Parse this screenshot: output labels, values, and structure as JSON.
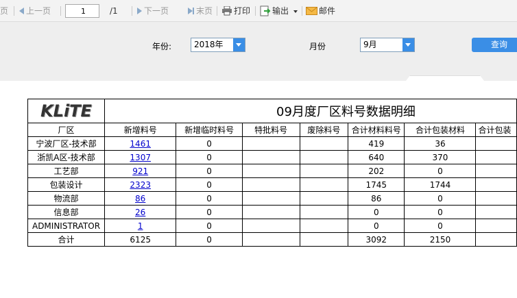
{
  "toolbar": {
    "first_page": "页",
    "prev_page": "上一页",
    "page_number": "1",
    "page_total": "/1",
    "next_page": "下一页",
    "last_page": "末页",
    "print": "打印",
    "export": "输出",
    "email": "邮件"
  },
  "query": {
    "year_label": "年份:",
    "year_value": "2018年",
    "month_label": "月份",
    "month_value": "9月",
    "query_button": "查询"
  },
  "report": {
    "logo": "KLiTE",
    "title": "09月度厂区料号数据明细",
    "columns": [
      "厂区",
      "新增料号",
      "新增临时料号",
      "特批料号",
      "废除料号",
      "合计材料料号",
      "合计包装材料",
      "合计包装"
    ],
    "rows": [
      [
        "宁波厂区-技术部",
        "1461",
        "0",
        "",
        "",
        "419",
        "36",
        ""
      ],
      [
        "浙凯A区-技术部",
        "1307",
        "0",
        "",
        "",
        "640",
        "370",
        ""
      ],
      [
        "工艺部",
        "921",
        "0",
        "",
        "",
        "202",
        "0",
        ""
      ],
      [
        "包装设计",
        "2323",
        "0",
        "",
        "",
        "1745",
        "1744",
        ""
      ],
      [
        "物流部",
        "86",
        "0",
        "",
        "",
        "86",
        "0",
        ""
      ],
      [
        "信息部",
        "26",
        "0",
        "",
        "",
        "0",
        "0",
        ""
      ],
      [
        "ADMINISTRATOR",
        "1",
        "0",
        "",
        "",
        "0",
        "0",
        ""
      ]
    ],
    "total": [
      "合计",
      "6125",
      "0",
      "",
      "",
      "3092",
      "2150",
      ""
    ]
  },
  "colors": {
    "accent": "#3a8ee6",
    "link": "#0000cc"
  }
}
